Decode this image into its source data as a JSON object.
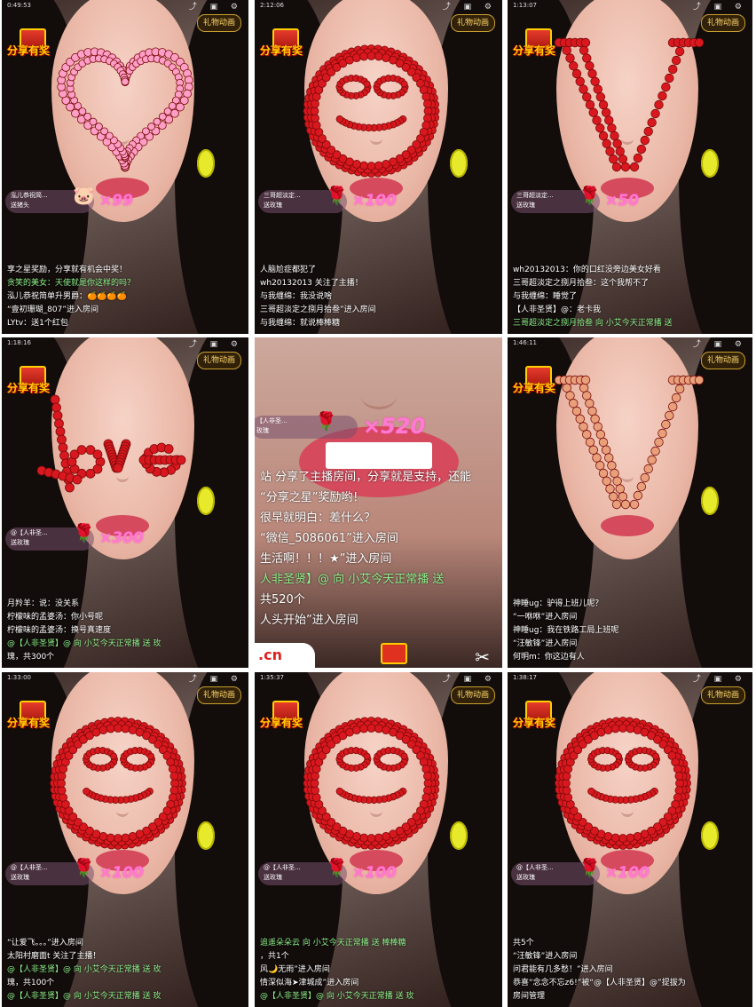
{
  "colors": {
    "rose": "#d8181e",
    "pink_heart": "#ff9fc8",
    "count": "#ff7bd2",
    "chat_green": "#8ef08a"
  },
  "share_label": "分享有奖",
  "anim_label": "礼物动画",
  "cells": [
    {
      "time": "0:49:53",
      "shape": "heart",
      "gift_who": [
        "泓儿恭祝简...",
        "送猪头"
      ],
      "gift_icon": "pig-icon",
      "gift_count": "×99",
      "chat": [
        "享之星奖励，分享就有机会中奖！",
        "贪笑的美女：天使就是你这样的吗？",
        "泓儿恭祝简单升男爵：🍊🍊🍊🍊",
        "“壹初珊瑚_807”进入房间",
        "LYtv：送1个红包"
      ],
      "chat_green": [
        1
      ]
    },
    {
      "time": "2:12:06",
      "shape": "smile",
      "gift_who": [
        "三哥超淡定...",
        "送玫瑰"
      ],
      "gift_icon": "rose-icon",
      "gift_count": "×100",
      "chat": [
        "人脑尬症都犯了",
        "wh20132013 关注了主播！",
        "与我缠绵：我没说啥",
        "三哥超淡定之捌月拾叁”进入房间",
        "与我缠绵：就说棒棒糖"
      ],
      "chat_green": []
    },
    {
      "time": "1:13:07",
      "shape": "v",
      "gift_who": [
        "三哥超淡定...",
        "送玫瑰"
      ],
      "gift_icon": "rose-icon",
      "gift_count": "×50",
      "chat": [
        "wh20132013：你的口红没旁边美女好看",
        "三哥超淡定之捌月拾叁：这个我帮不了",
        "与我缠绵：睡觉了",
        "【人非圣贤】@：老卡我",
        "三哥超淡定之捌月拾叁 向 小艾今天正常播 送"
      ],
      "chat_green": [
        4
      ]
    },
    {
      "time": "1:18:16",
      "shape": "love",
      "gift_who": [
        "@【人非圣...",
        "送玫瑰"
      ],
      "gift_icon": "rose-icon",
      "gift_count": "×300",
      "chat": [
        "月羚羊：说：没关系",
        "柠檬味的孟婆汤：你小号呢",
        "柠檬味的孟婆汤：换号真速度",
        "@【人非圣贤】@ 向 小艾今天正常播 送 玫",
        "瑰，共300个"
      ],
      "chat_green": [
        3
      ]
    },
    {
      "time": "",
      "shape": "none",
      "gift_who": [
        "【人非圣...",
        "玫瑰"
      ],
      "gift_icon": "rose-icon",
      "gift_count": "×520",
      "chat": [
        "站 分享了主播房间，分享就是支持，还能",
        "“分享之星”奖励哟！",
        "很早就明白：差什么？",
        "“微信_5086061”进入房间",
        "生活啊！！！★”进入房间",
        "人非圣贤】@ 向 小艾今天正常播 送",
        "共520个",
        "人头开始”进入房间"
      ],
      "chat_green": [
        5
      ]
    },
    {
      "time": "1:46:11",
      "shape": "v2",
      "gift_who": [],
      "gift_icon": "",
      "gift_count": "",
      "chat": [
        "神睡ug：驴得上班儿呢？",
        "“一咻咻”进入房间",
        "神睡ug：我在铁路工局上班呢",
        "“汪敏锋”进入房间",
        "何明m：你这边有人"
      ],
      "chat_green": []
    },
    {
      "time": "1:33:00",
      "shape": "smile",
      "gift_who": [
        "@【人非圣...",
        "送玫瑰"
      ],
      "gift_icon": "rose-icon",
      "gift_count": "×100",
      "chat": [
        "“让爱飞。。。”进入房间",
        "太阳村磨面t 关注了主播！",
        "@【人非圣贤】@ 向 小艾今天正常播 送 玫",
        "瑰，共100个",
        "@【人非圣贤】@ 向 小艾今天正常播 送 玫"
      ],
      "chat_green": [
        2,
        4
      ]
    },
    {
      "time": "1:35:37",
      "shape": "smile",
      "gift_who": [
        "@【人非圣...",
        "送玫瑰"
      ],
      "gift_icon": "rose-icon",
      "gift_count": "×100",
      "chat": [
        "追遥朵朵云 向 小艾今天正常播 送 棒棒糖",
        "，共1个",
        "风🌙无雨”进入房间",
        "情深似海➤津城成”进入房间",
        "@【人非圣贤】@ 向 小艾今天正常播 送 玫"
      ],
      "chat_green": [
        0,
        4
      ]
    },
    {
      "time": "1:38:17",
      "shape": "smile",
      "gift_who": [
        "@【人非圣...",
        "送玫瑰"
      ],
      "gift_icon": "rose-icon",
      "gift_count": "×100",
      "chat": [
        "共5个",
        "“汪敏锋”进入房间",
        "问君能有几多愁！”进入房间",
        "恭喜“念念不忘z6!”被“@【人非圣贤】@”提拔为",
        "房间管理"
      ],
      "chat_green": []
    }
  ]
}
